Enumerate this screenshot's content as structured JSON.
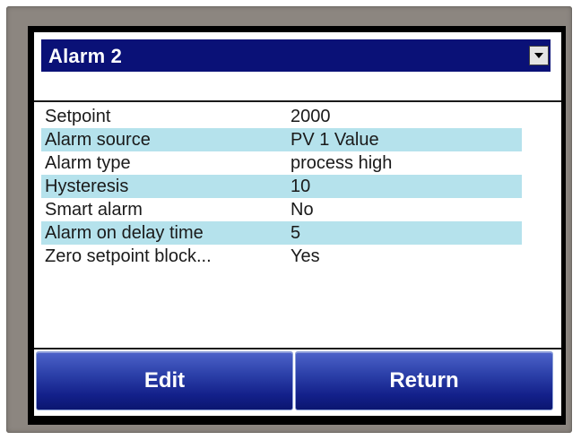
{
  "header": {
    "title": "Alarm 2",
    "dropdown_icon": "chevron-down-icon"
  },
  "parameters": [
    {
      "label": "Setpoint",
      "value": "2000"
    },
    {
      "label": "Alarm source",
      "value": "PV 1 Value"
    },
    {
      "label": "Alarm type",
      "value": "process high"
    },
    {
      "label": "Hysteresis",
      "value": "10"
    },
    {
      "label": "Smart alarm",
      "value": "No"
    },
    {
      "label": "Alarm on delay time",
      "value": "5"
    },
    {
      "label": "Zero setpoint block...",
      "value": "Yes"
    }
  ],
  "buttons": {
    "edit_label": "Edit",
    "return_label": "Return"
  },
  "colors": {
    "title_bar": "#0a1177",
    "row_highlight": "#b5e2ec",
    "button": "#1a2a96",
    "bezel": "#8c8680"
  }
}
